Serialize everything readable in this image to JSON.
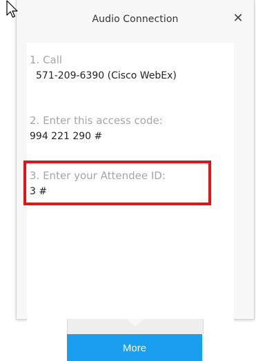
{
  "dialog": {
    "title": "Audio Connection",
    "close_icon": "close-icon"
  },
  "steps": [
    {
      "label": "1. Call",
      "value": "571-209-6390 (Cisco WebEx)"
    },
    {
      "label": "2. Enter this access code:",
      "value": "994 221 290 #"
    },
    {
      "label": "3. Enter your Attendee ID:",
      "value": "3 #"
    }
  ],
  "more_button": {
    "label": "More"
  },
  "colors": {
    "accent": "#1a9ef0",
    "highlight": "#e01515",
    "label_gray": "#a5a5a5"
  }
}
